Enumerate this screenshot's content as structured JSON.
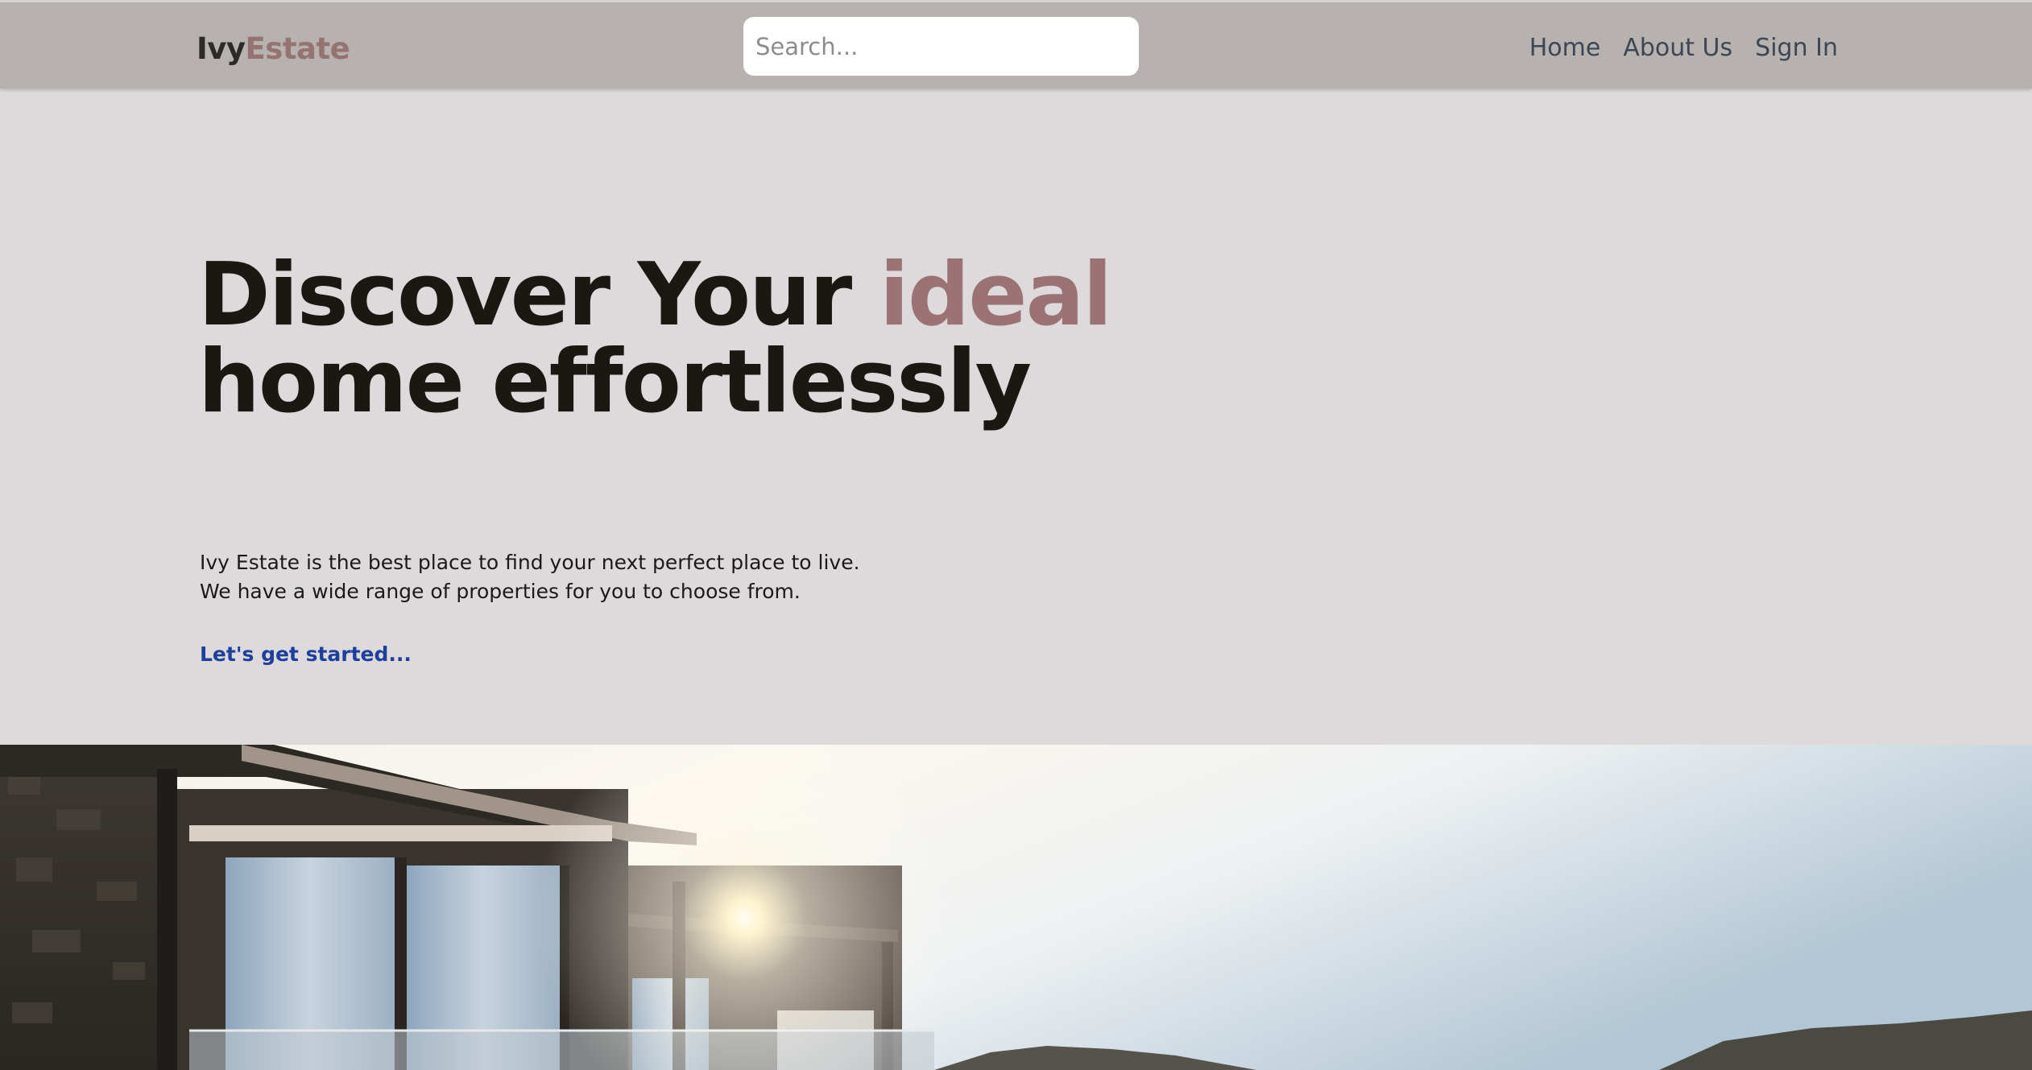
{
  "header": {
    "logo": {
      "part1": "Ivy",
      "part2": "Estate"
    },
    "search": {
      "placeholder": "Search..."
    },
    "nav": {
      "home": "Home",
      "about": "About Us",
      "signin": "Sign In"
    }
  },
  "hero": {
    "headline_part1": "Discover Your ",
    "headline_accent": "ideal",
    "headline_line2": "home effortlessly",
    "description_line1": "Ivy Estate is the best place to find your next perfect place to live.",
    "description_line2": "We have a wide range of properties for you to choose from.",
    "cta": "Let's get started..."
  },
  "colors": {
    "header_bg": "#b7b2af",
    "page_bg": "#dedadb",
    "accent": "#9b7375",
    "link": "#1d3f9d"
  }
}
